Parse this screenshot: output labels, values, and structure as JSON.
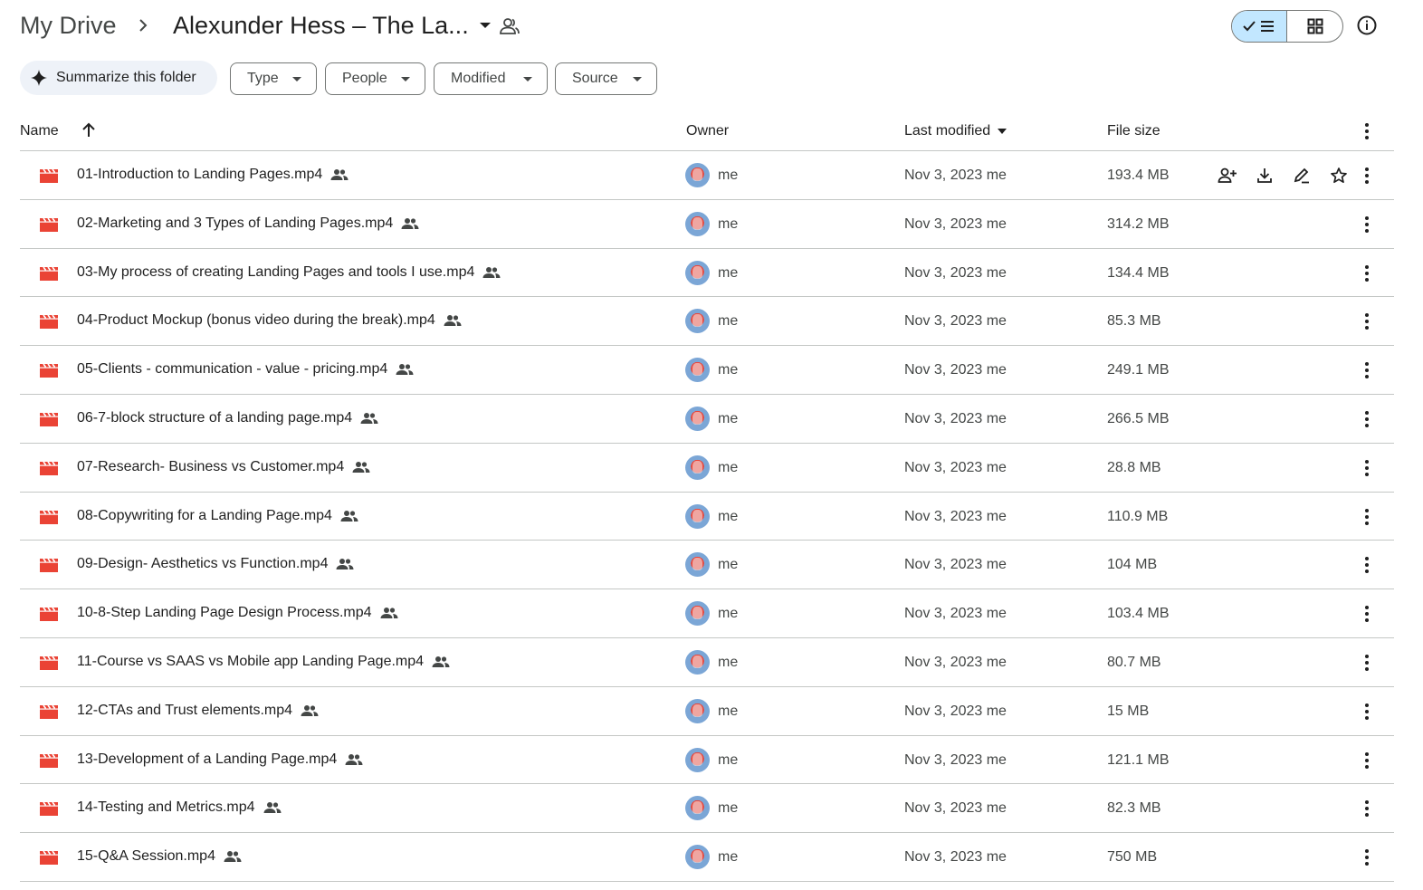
{
  "breadcrumb": {
    "root": "My Drive",
    "current": "Alexunder Hess – The La..."
  },
  "toolbar": {
    "summarize_label": "Summarize this folder",
    "filters": [
      "Type",
      "People",
      "Modified",
      "Source"
    ]
  },
  "table": {
    "columns": {
      "name": "Name",
      "owner": "Owner",
      "modified": "Last modified",
      "size": "File size"
    },
    "rows": [
      {
        "name": "01-Introduction to Landing Pages.mp4",
        "owner": "me",
        "modified": "Nov 3, 2023 me",
        "size": "193.4 MB"
      },
      {
        "name": "02-Marketing and 3 Types of Landing Pages.mp4",
        "owner": "me",
        "modified": "Nov 3, 2023 me",
        "size": "314.2 MB"
      },
      {
        "name": "03-My process of creating Landing Pages and tools I use.mp4",
        "owner": "me",
        "modified": "Nov 3, 2023 me",
        "size": "134.4 MB"
      },
      {
        "name": "04-Product Mockup (bonus video during the break).mp4",
        "owner": "me",
        "modified": "Nov 3, 2023 me",
        "size": "85.3 MB"
      },
      {
        "name": "05-Clients - communication - value - pricing.mp4",
        "owner": "me",
        "modified": "Nov 3, 2023 me",
        "size": "249.1 MB"
      },
      {
        "name": "06-7-block structure of a landing page.mp4",
        "owner": "me",
        "modified": "Nov 3, 2023 me",
        "size": "266.5 MB"
      },
      {
        "name": "07-Research- Business vs Customer.mp4",
        "owner": "me",
        "modified": "Nov 3, 2023 me",
        "size": "28.8 MB"
      },
      {
        "name": "08-Copywriting for a Landing Page.mp4",
        "owner": "me",
        "modified": "Nov 3, 2023 me",
        "size": "110.9 MB"
      },
      {
        "name": "09-Design- Aesthetics vs Function.mp4",
        "owner": "me",
        "modified": "Nov 3, 2023 me",
        "size": "104 MB"
      },
      {
        "name": "10-8-Step Landing Page Design Process.mp4",
        "owner": "me",
        "modified": "Nov 3, 2023 me",
        "size": "103.4 MB"
      },
      {
        "name": "11-Course vs SAAS vs Mobile app Landing Page.mp4",
        "owner": "me",
        "modified": "Nov 3, 2023 me",
        "size": "80.7 MB"
      },
      {
        "name": "12-CTAs and Trust elements.mp4",
        "owner": "me",
        "modified": "Nov 3, 2023 me",
        "size": "15 MB"
      },
      {
        "name": "13-Development of a Landing Page.mp4",
        "owner": "me",
        "modified": "Nov 3, 2023 me",
        "size": "121.1 MB"
      },
      {
        "name": "14-Testing and Metrics.mp4",
        "owner": "me",
        "modified": "Nov 3, 2023 me",
        "size": "82.3 MB"
      },
      {
        "name": "15-Q&A Session.mp4",
        "owner": "me",
        "modified": "Nov 3, 2023 me",
        "size": "750 MB"
      }
    ]
  },
  "colors": {
    "video_icon": "#ea4335",
    "active_toggle": "#c2e7ff",
    "summarize_bg": "#eef2f8"
  },
  "icons": {
    "file_type": "video-file-icon",
    "shared": "shared-people-icon",
    "row_actions": [
      "share-icon",
      "download-icon",
      "rename-icon",
      "star-icon"
    ]
  }
}
